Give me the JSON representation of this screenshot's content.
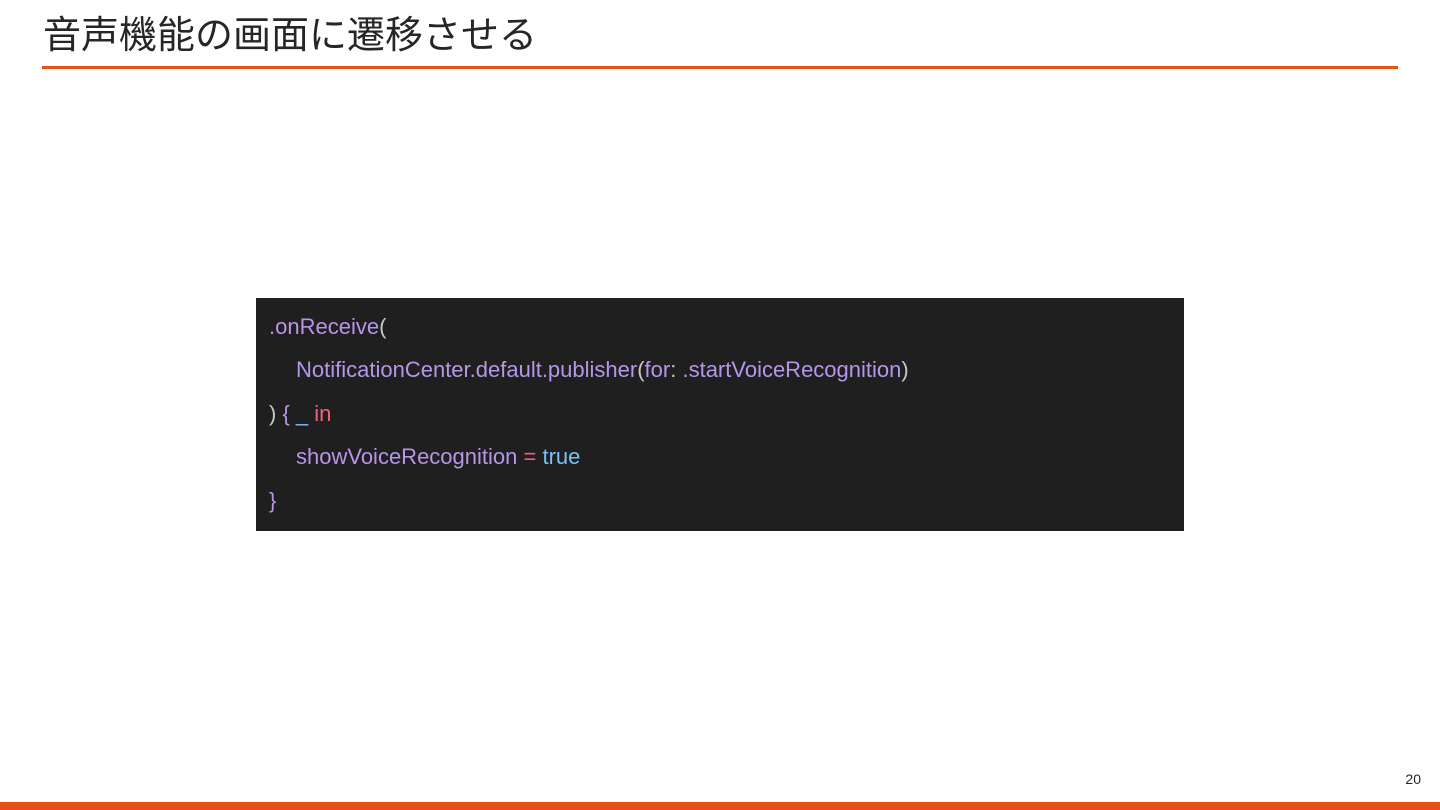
{
  "slide": {
    "title": "音声機能の画面に遷移させる",
    "page_number": "20",
    "accent_color": "#e8501a"
  },
  "code": {
    "background_color": "#1f1f1f",
    "lines": [
      {
        "tokens": [
          {
            "text": ".onReceive",
            "kind": "name"
          },
          {
            "text": "(",
            "kind": "punct"
          }
        ]
      },
      {
        "tokens": [
          {
            "text": "NotificationCenter.default.publisher",
            "kind": "name"
          },
          {
            "text": "(",
            "kind": "punct"
          },
          {
            "text": "for",
            "kind": "name"
          },
          {
            "text": ": ",
            "kind": "punct"
          },
          {
            "text": ".startVoiceRecognition",
            "kind": "name"
          },
          {
            "text": ")",
            "kind": "punct"
          }
        ]
      },
      {
        "tokens": [
          {
            "text": ") ",
            "kind": "punct"
          },
          {
            "text": "{ ",
            "kind": "name"
          },
          {
            "text": "_",
            "kind": "under"
          },
          {
            "text": " ",
            "kind": "punct"
          },
          {
            "text": "in",
            "kind": "keyword"
          }
        ]
      },
      {
        "tokens": [
          {
            "text": "showVoiceRecognition",
            "kind": "name"
          },
          {
            "text": " ",
            "kind": "punct"
          },
          {
            "text": "=",
            "kind": "keyword"
          },
          {
            "text": " ",
            "kind": "punct"
          },
          {
            "text": "true",
            "kind": "literal"
          }
        ]
      },
      {
        "tokens": [
          {
            "text": "}",
            "kind": "name"
          }
        ]
      }
    ]
  }
}
